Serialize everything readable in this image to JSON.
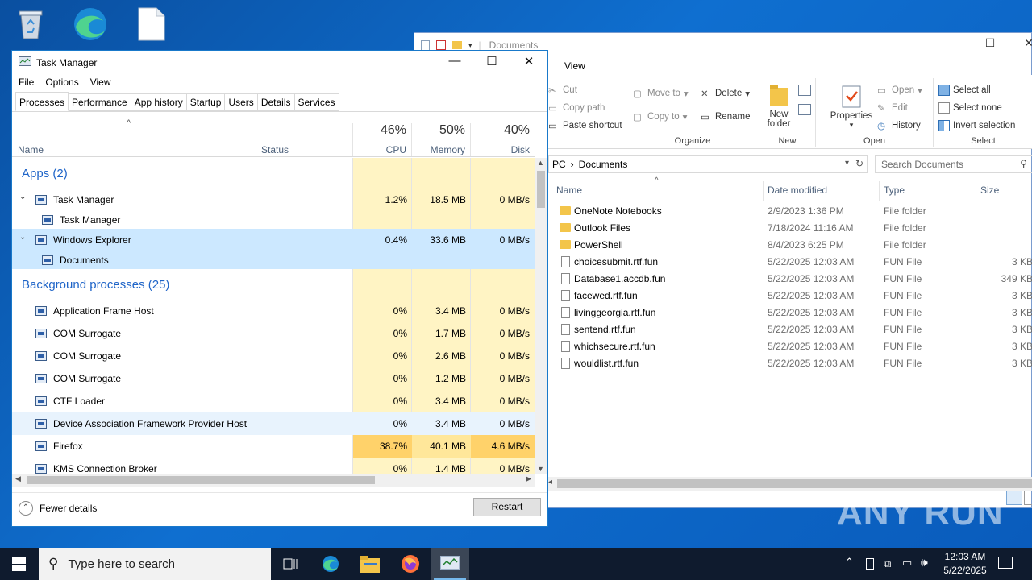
{
  "desktop": {
    "icons": [
      "recycle-bin-icon",
      "edge-icon",
      "blank-file-icon"
    ]
  },
  "explorer": {
    "title": "Documents",
    "ribbon_tab_view": "View",
    "clipboard": {
      "cut": "Cut",
      "copy_path": "Copy path",
      "paste_shortcut": "Paste shortcut"
    },
    "organize": {
      "move_to": "Move to",
      "copy_to": "Copy to",
      "delete": "Delete",
      "rename": "Rename",
      "label": "Organize"
    },
    "new": {
      "new_folder_line1": "New",
      "new_folder_line2": "folder",
      "label": "New"
    },
    "open": {
      "properties": "Properties",
      "open": "Open",
      "edit": "Edit",
      "history": "History",
      "label": "Open"
    },
    "select": {
      "select_all": "Select all",
      "select_none": "Select none",
      "invert": "Invert selection",
      "label": "Select"
    },
    "address": {
      "pc": "PC",
      "sep": "›",
      "folder": "Documents"
    },
    "search_placeholder": "Search Documents",
    "columns": {
      "name": "Name",
      "date": "Date modified",
      "type": "Type",
      "size": "Size"
    },
    "files": [
      {
        "name": "OneNote Notebooks",
        "date": "2/9/2023 1:36 PM",
        "type": "File folder",
        "size": "",
        "kind": "folder"
      },
      {
        "name": "Outlook Files",
        "date": "7/18/2024 11:16 AM",
        "type": "File folder",
        "size": "",
        "kind": "folder"
      },
      {
        "name": "PowerShell",
        "date": "8/4/2023 6:25 PM",
        "type": "File folder",
        "size": "",
        "kind": "folder"
      },
      {
        "name": "choicesubmit.rtf.fun",
        "date": "5/22/2025 12:03 AM",
        "type": "FUN File",
        "size": "3 KB",
        "kind": "file"
      },
      {
        "name": "Database1.accdb.fun",
        "date": "5/22/2025 12:03 AM",
        "type": "FUN File",
        "size": "349 KB",
        "kind": "file"
      },
      {
        "name": "facewed.rtf.fun",
        "date": "5/22/2025 12:03 AM",
        "type": "FUN File",
        "size": "3 KB",
        "kind": "file"
      },
      {
        "name": "livinggeorgia.rtf.fun",
        "date": "5/22/2025 12:03 AM",
        "type": "FUN File",
        "size": "3 KB",
        "kind": "file"
      },
      {
        "name": "sentend.rtf.fun",
        "date": "5/22/2025 12:03 AM",
        "type": "FUN File",
        "size": "3 KB",
        "kind": "file"
      },
      {
        "name": "whichsecure.rtf.fun",
        "date": "5/22/2025 12:03 AM",
        "type": "FUN File",
        "size": "3 KB",
        "kind": "file"
      },
      {
        "name": "wouldlist.rtf.fun",
        "date": "5/22/2025 12:03 AM",
        "type": "FUN File",
        "size": "3 KB",
        "kind": "file"
      }
    ]
  },
  "taskmgr": {
    "title": "Task Manager",
    "menu": [
      "File",
      "Options",
      "View"
    ],
    "tabs": [
      "Processes",
      "Performance",
      "App history",
      "Startup",
      "Users",
      "Details",
      "Services"
    ],
    "columns": {
      "name": "Name",
      "status": "Status",
      "cpu_pct": "46%",
      "cpu": "CPU",
      "mem_pct": "50%",
      "mem": "Memory",
      "disk_pct": "40%",
      "disk": "Disk"
    },
    "apps_group": "Apps (2)",
    "bg_group": "Background processes (25)",
    "rows": [
      {
        "name": "Task Manager",
        "cpu": "1.2%",
        "mem": "18.5 MB",
        "disk": "0 MB/s"
      },
      {
        "name": "Task Manager",
        "cpu": "",
        "mem": "",
        "disk": ""
      },
      {
        "name": "Windows Explorer",
        "cpu": "0.4%",
        "mem": "33.6 MB",
        "disk": "0 MB/s"
      },
      {
        "name": "Documents",
        "cpu": "",
        "mem": "",
        "disk": ""
      },
      {
        "name": "Application Frame Host",
        "cpu": "0%",
        "mem": "3.4 MB",
        "disk": "0 MB/s"
      },
      {
        "name": "COM Surrogate",
        "cpu": "0%",
        "mem": "1.7 MB",
        "disk": "0 MB/s"
      },
      {
        "name": "COM Surrogate",
        "cpu": "0%",
        "mem": "2.6 MB",
        "disk": "0 MB/s"
      },
      {
        "name": "COM Surrogate",
        "cpu": "0%",
        "mem": "1.2 MB",
        "disk": "0 MB/s"
      },
      {
        "name": "CTF Loader",
        "cpu": "0%",
        "mem": "3.4 MB",
        "disk": "0 MB/s"
      },
      {
        "name": "Device Association Framework Provider Host",
        "cpu": "0%",
        "mem": "3.4 MB",
        "disk": "0 MB/s"
      },
      {
        "name": "Firefox",
        "cpu": "38.7%",
        "mem": "40.1 MB",
        "disk": "4.6 MB/s"
      },
      {
        "name": "KMS Connection Broker",
        "cpu": "0%",
        "mem": "1.4 MB",
        "disk": "0 MB/s"
      }
    ],
    "fewer_details": "Fewer details",
    "restart": "Restart"
  },
  "taskbar": {
    "search_placeholder": "Type here to search",
    "time": "12:03 AM",
    "date": "5/22/2025",
    "pinned": [
      "task-view-icon",
      "edge-icon",
      "file-explorer-icon",
      "firefox-icon",
      "task-manager-icon"
    ]
  },
  "watermark": "ANY RUN",
  "colors": {
    "accent": "#0078d7",
    "highlight_row": "#cce8ff",
    "heat_low": "#fff4c4",
    "heat_high": "#ffd26a"
  }
}
